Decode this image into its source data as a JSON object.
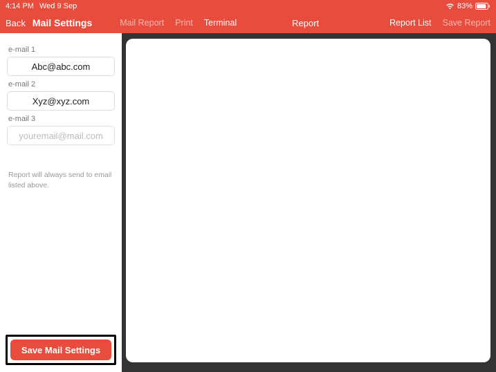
{
  "status_bar": {
    "time": "4:14 PM",
    "date": "Wed 9 Sep",
    "battery_pct": "83%"
  },
  "header": {
    "back_label": "Back",
    "title": "Mail Settings",
    "tabs": {
      "mail_report": "Mail Report",
      "print": "Print",
      "terminal": "Terminal",
      "report": "Report",
      "report_list": "Report List",
      "save_report": "Save Report"
    }
  },
  "sidebar": {
    "fields": {
      "email1": {
        "label": "e-mail 1",
        "value": "Abc@abc.com"
      },
      "email2": {
        "label": "e-mail 2",
        "value": "Xyz@xyz.com"
      },
      "email3": {
        "label": "e-mail 3",
        "value": "",
        "placeholder": "youremail@mail.com"
      }
    },
    "help_text": "Report will always send to email listed above.",
    "save_button": "Save Mail Settings"
  },
  "colors": {
    "accent": "#e74c3c",
    "dark_bg": "#333333"
  }
}
